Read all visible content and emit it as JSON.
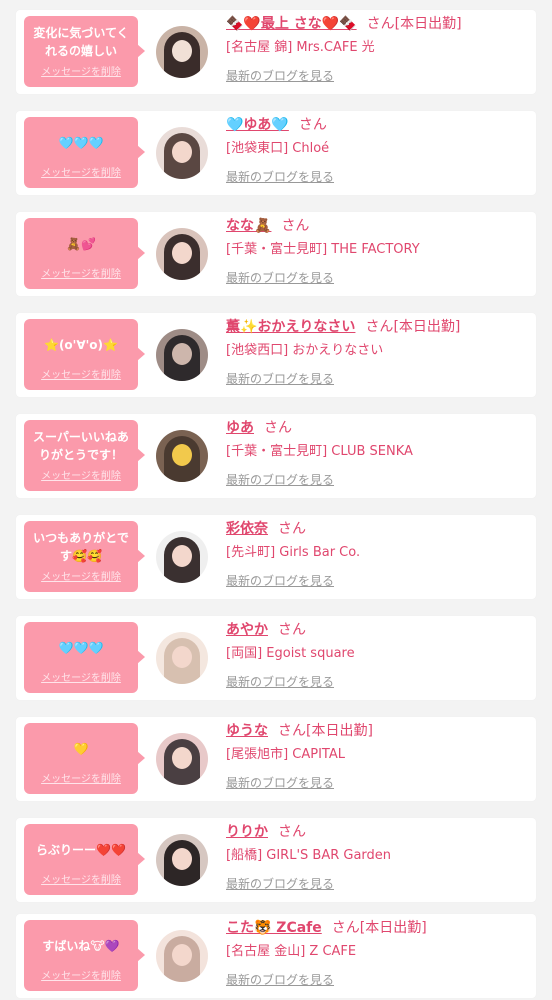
{
  "common": {
    "delete_label": "メッセージを削除",
    "blog_label": "最新のブログを見る",
    "san_label": "さん"
  },
  "colors": {
    "bubble": "#fb9aab",
    "accent_text": "#e0476e",
    "link_gray": "#999999",
    "page_background": "#f3f3f3"
  },
  "items": [
    {
      "message": "変化に気づいてくれるの嬉しい",
      "name": "🍫❤️最上 さな❤️🍫",
      "status": "[本日出勤]",
      "shop": "[名古屋 錦] Mrs.CAFE 光",
      "avatar_icon": "avatar-photo-icon",
      "avatar_colors": [
        "#c9b3a6",
        "#f1e0d6"
      ]
    },
    {
      "message": "🩵🩵🩵",
      "name": "🩵ゆあ🩵",
      "status": "",
      "shop": "[池袋東口] Chloé",
      "avatar_icon": "avatar-photo-icon",
      "avatar_colors": [
        "#5a4742",
        "#e9dcd8"
      ]
    },
    {
      "message": "🧸💕",
      "name": "なな🧸",
      "status": "",
      "shop": "[千葉・富士見町] THE FACTORY",
      "avatar_icon": "avatar-photo-icon",
      "avatar_colors": [
        "#3b2e2d",
        "#d9c3bb"
      ]
    },
    {
      "message": "⭐(o'∀'o)⭐",
      "name": "薫✨おかえりなさい",
      "status": "[本日出勤]",
      "shop": "[池袋西口] おかえりなさい",
      "avatar_icon": "avatar-photo-icon",
      "avatar_colors": [
        "#2e2a2c",
        "#9e8c86"
      ]
    },
    {
      "message": "スーパーいいねありがとうです！",
      "name": "ゆあ",
      "status": "",
      "shop": "[千葉・富士見町] CLUB SENKA",
      "avatar_icon": "avatar-photo-icon",
      "avatar_colors": [
        "#7a6252",
        "#f2c94c"
      ]
    },
    {
      "message": "いつもありがとです🥰🥰",
      "name": "彩依奈",
      "status": "",
      "shop": "[先斗町] Girls Bar Co.",
      "avatar_icon": "avatar-photo-icon",
      "avatar_colors": [
        "#efefef",
        "#3a3030"
      ]
    },
    {
      "message": "🩵🩵🩵",
      "name": "あやか",
      "status": "",
      "shop": "[両国] Egoist square",
      "avatar_icon": "avatar-photo-icon",
      "avatar_colors": [
        "#d7c0b0",
        "#f4e7df"
      ]
    },
    {
      "message": "💛",
      "name": "ゆうな",
      "status": "[本日出勤]",
      "shop": "[尾張旭市] CAPITAL",
      "avatar_icon": "avatar-photo-icon",
      "avatar_colors": [
        "#4a3f42",
        "#e8c9c9"
      ]
    },
    {
      "message": "らぶりーー❤️❤️",
      "name": "りりか",
      "status": "",
      "shop": "[船橋] GIRL'S BAR Garden",
      "avatar_icon": "avatar-photo-icon",
      "avatar_colors": [
        "#2d2626",
        "#d6c7c1"
      ]
    },
    {
      "message": "すばいね🐮💜",
      "name": "こた🐯 ZCafe",
      "status": "[本日出勤]",
      "shop": "[名古屋 金山] Z CAFE",
      "avatar_icon": "avatar-photo-icon",
      "avatar_colors": [
        "#c9aca0",
        "#f3e3dc"
      ]
    }
  ]
}
